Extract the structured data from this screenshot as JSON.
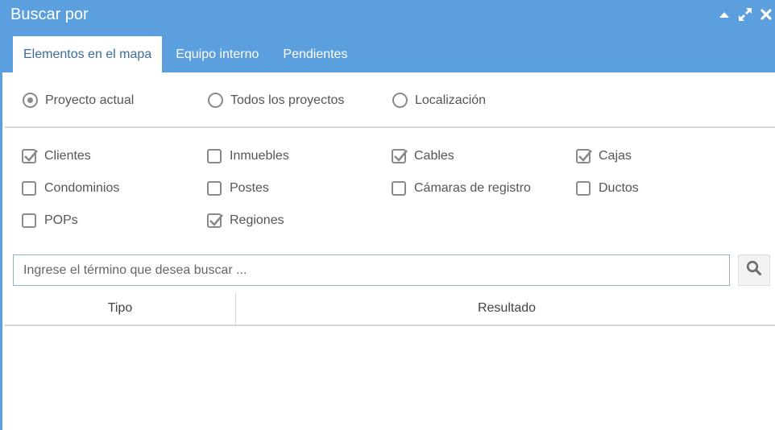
{
  "window": {
    "title": "Buscar por"
  },
  "tabs": [
    {
      "label": "Elementos en el mapa",
      "active": true
    },
    {
      "label": "Equipo interno",
      "active": false
    },
    {
      "label": "Pendientes",
      "active": false
    }
  ],
  "scope": {
    "options": [
      {
        "label": "Proyecto actual",
        "checked": true
      },
      {
        "label": "Todos los proyectos",
        "checked": false
      },
      {
        "label": "Localización",
        "checked": false
      }
    ]
  },
  "filters": {
    "items": [
      {
        "label": "Clientes",
        "checked": true
      },
      {
        "label": "Inmuebles",
        "checked": false
      },
      {
        "label": "Cables",
        "checked": true
      },
      {
        "label": "Cajas",
        "checked": true
      },
      {
        "label": "Condominios",
        "checked": false
      },
      {
        "label": "Postes",
        "checked": false
      },
      {
        "label": "Cámaras de registro",
        "checked": false
      },
      {
        "label": "Ductos",
        "checked": false
      },
      {
        "label": "POPs",
        "checked": false
      },
      {
        "label": "Regiones",
        "checked": true
      }
    ]
  },
  "search": {
    "placeholder": "Ingrese el término que desea buscar ...",
    "value": ""
  },
  "results": {
    "columns": [
      "Tipo",
      "Resultado"
    ]
  },
  "icons": {
    "collapse": "caret-up-icon",
    "maximize": "expand-icon",
    "close": "close-icon",
    "search": "search-icon"
  },
  "colors": {
    "header": "#5b9fde",
    "active_tab_text": "#3d6d9c",
    "control_gray": "#8a8a8a"
  }
}
